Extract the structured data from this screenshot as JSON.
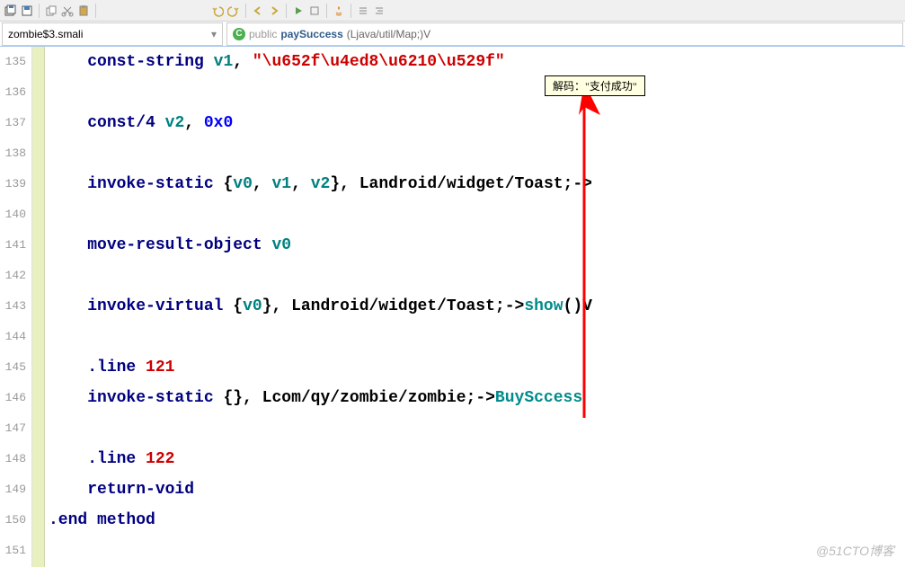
{
  "toolbar": {
    "icons": [
      "save-all",
      "open",
      "cut",
      "copy",
      "paste"
    ],
    "icons2": [
      "undo",
      "redo",
      "back",
      "forward"
    ],
    "icons3": [
      "play",
      "debug",
      "new",
      "align-left",
      "align-right"
    ]
  },
  "nav": {
    "filename": "zombie$3.smali",
    "method_modifier": "public",
    "method_name": "paySuccess",
    "method_signature": "(Ljava/util/Map;)V"
  },
  "tooltip": {
    "text": "解码：\"支付成功\""
  },
  "lines": [
    {
      "num": "135",
      "tokens": [
        {
          "t": "    ",
          "c": ""
        },
        {
          "t": "const-string",
          "c": "kw"
        },
        {
          "t": " ",
          "c": ""
        },
        {
          "t": "v1",
          "c": "reg"
        },
        {
          "t": ", ",
          "c": "punct"
        },
        {
          "t": "\"\\u652f\\u4ed8\\u6210\\u529f\"",
          "c": "str"
        }
      ]
    },
    {
      "num": "136",
      "tokens": []
    },
    {
      "num": "137",
      "tokens": [
        {
          "t": "    ",
          "c": ""
        },
        {
          "t": "const/4",
          "c": "kw"
        },
        {
          "t": " ",
          "c": ""
        },
        {
          "t": "v2",
          "c": "reg"
        },
        {
          "t": ", ",
          "c": "punct"
        },
        {
          "t": "0x0",
          "c": "lit"
        }
      ]
    },
    {
      "num": "138",
      "tokens": []
    },
    {
      "num": "139",
      "tokens": [
        {
          "t": "    ",
          "c": ""
        },
        {
          "t": "invoke-static",
          "c": "kw"
        },
        {
          "t": " {",
          "c": "punct"
        },
        {
          "t": "v0",
          "c": "reg"
        },
        {
          "t": ", ",
          "c": "punct"
        },
        {
          "t": "v1",
          "c": "reg"
        },
        {
          "t": ", ",
          "c": "punct"
        },
        {
          "t": "v2",
          "c": "reg"
        },
        {
          "t": "}, ",
          "c": "punct"
        },
        {
          "t": "Landroid/widget/Toast;",
          "c": "cls"
        },
        {
          "t": "->",
          "c": "punct"
        }
      ]
    },
    {
      "num": "140",
      "tokens": []
    },
    {
      "num": "141",
      "tokens": [
        {
          "t": "    ",
          "c": ""
        },
        {
          "t": "move-result-object",
          "c": "kw"
        },
        {
          "t": " ",
          "c": ""
        },
        {
          "t": "v0",
          "c": "reg"
        }
      ]
    },
    {
      "num": "142",
      "tokens": []
    },
    {
      "num": "143",
      "tokens": [
        {
          "t": "    ",
          "c": ""
        },
        {
          "t": "invoke-virtual",
          "c": "kw"
        },
        {
          "t": " {",
          "c": "punct"
        },
        {
          "t": "v0",
          "c": "reg"
        },
        {
          "t": "}, ",
          "c": "punct"
        },
        {
          "t": "Landroid/widget/Toast;",
          "c": "cls"
        },
        {
          "t": "->",
          "c": "punct"
        },
        {
          "t": "show",
          "c": "mth"
        },
        {
          "t": "()V",
          "c": "cls"
        }
      ]
    },
    {
      "num": "144",
      "tokens": []
    },
    {
      "num": "145",
      "tokens": [
        {
          "t": "    ",
          "c": ""
        },
        {
          "t": ".line",
          "c": "kw"
        },
        {
          "t": " ",
          "c": ""
        },
        {
          "t": "121",
          "c": "num"
        }
      ]
    },
    {
      "num": "146",
      "tokens": [
        {
          "t": "    ",
          "c": ""
        },
        {
          "t": "invoke-static",
          "c": "kw"
        },
        {
          "t": " {}, ",
          "c": "punct"
        },
        {
          "t": "Lcom/qy/zombie/zombie;",
          "c": "cls"
        },
        {
          "t": "->",
          "c": "punct"
        },
        {
          "t": "BuySccess",
          "c": "mth"
        },
        {
          "t": " ",
          "c": ""
        }
      ]
    },
    {
      "num": "147",
      "tokens": []
    },
    {
      "num": "148",
      "tokens": [
        {
          "t": "    ",
          "c": ""
        },
        {
          "t": ".line",
          "c": "kw"
        },
        {
          "t": " ",
          "c": ""
        },
        {
          "t": "122",
          "c": "num"
        }
      ]
    },
    {
      "num": "149",
      "tokens": [
        {
          "t": "    ",
          "c": ""
        },
        {
          "t": "return-void",
          "c": "kw"
        }
      ]
    },
    {
      "num": "150",
      "tokens": [
        {
          "t": ".end method",
          "c": "kw"
        }
      ]
    },
    {
      "num": "151",
      "tokens": []
    }
  ],
  "watermark": "@51CTO博客"
}
